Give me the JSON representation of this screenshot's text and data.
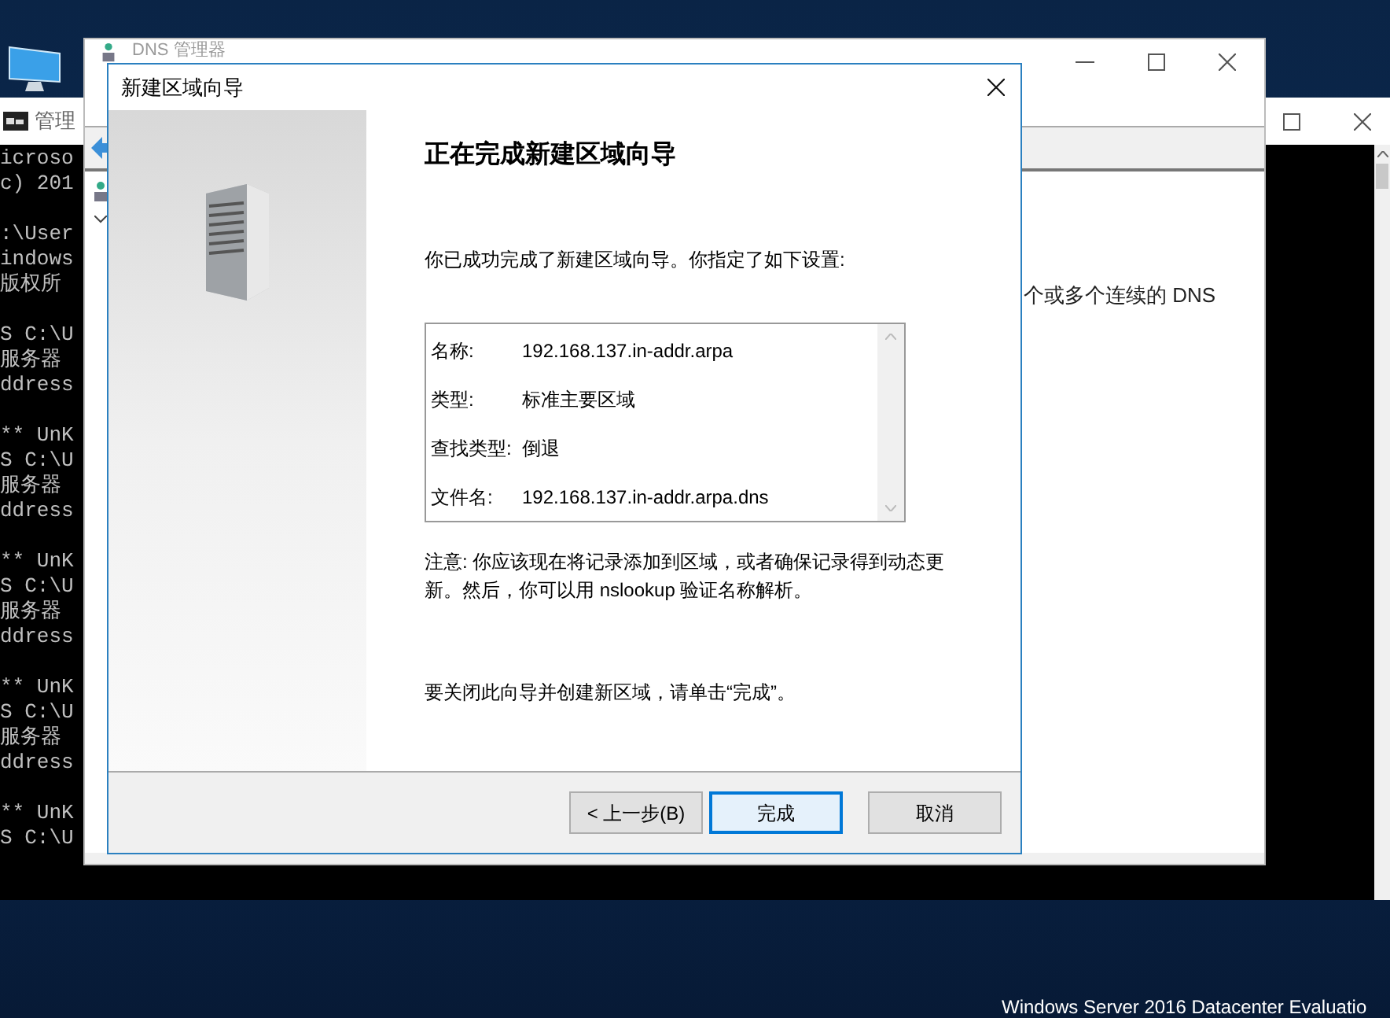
{
  "console": {
    "title": "管理",
    "blocks": [
      [
        "icroso",
        "c) 201"
      ],
      [
        ":\\User",
        "indows",
        "版权所"
      ],
      [
        "S C:\\U",
        "服务器",
        "ddress"
      ],
      [
        "** UnK",
        "S C:\\U",
        "服务器",
        "ddress"
      ],
      [
        "** UnK",
        "S C:\\U",
        "服务器",
        "ddress"
      ],
      [
        "** UnK",
        "S C:\\U",
        "服务器",
        "ddress"
      ],
      [
        "** UnK",
        "S C:\\U"
      ]
    ]
  },
  "dns_manager": {
    "title": "DNS 管理器",
    "pane_text": "个或多个连续的 DNS"
  },
  "wizard": {
    "title": "新建区域向导",
    "heading": "正在完成新建区域向导",
    "intro": "你已成功完成了新建区域向导。你指定了如下设置:",
    "settings": [
      {
        "label": "名称:",
        "value": "192.168.137.in-addr.arpa"
      },
      {
        "label": "类型:",
        "value": "标准主要区域"
      },
      {
        "label": "查找类型:",
        "value": "倒退"
      },
      {
        "label": "文件名:",
        "value": "192.168.137.in-addr.arpa.dns"
      }
    ],
    "note": "注意: 你应该现在将记录添加到区域，或者确保记录得到动态更新。然后，你可以用 nslookup 验证名称解析。",
    "closing": "要关闭此向导并创建新区域，请单击“完成”。",
    "buttons": [
      {
        "label": "< 上一步(B)",
        "default": false
      },
      {
        "label": "完成",
        "default": true
      },
      {
        "label": "取消",
        "default": false
      }
    ]
  },
  "desktop": {
    "edition": "Windows Server 2016 Datacenter Evaluatio"
  }
}
